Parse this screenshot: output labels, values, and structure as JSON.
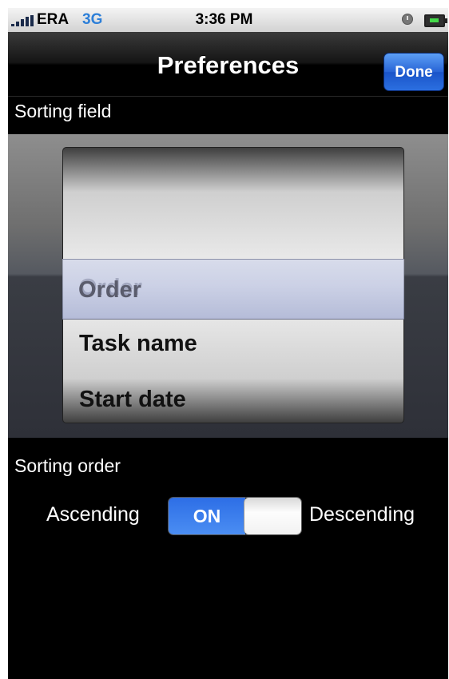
{
  "status_bar": {
    "carrier": "ERA",
    "network": "3G",
    "time": "3:36 PM",
    "network_color": "#2d7fd8",
    "battery_color": "#44d94a"
  },
  "nav": {
    "title": "Preferences",
    "done_label": "Done"
  },
  "sorting_field": {
    "header": "Sorting field",
    "options": [
      "Order",
      "Task name",
      "Start date"
    ],
    "selected": "Order"
  },
  "sorting_order": {
    "header": "Sorting order",
    "left_label": "Ascending",
    "right_label": "Descending",
    "toggle_state": "ON",
    "toggle_color": "#2d6ee6"
  }
}
